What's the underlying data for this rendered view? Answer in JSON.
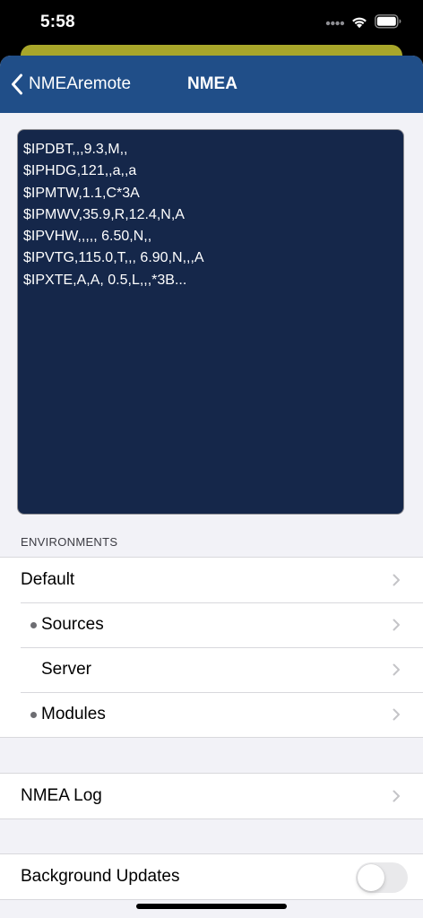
{
  "status_bar": {
    "time": "5:58"
  },
  "colors": {
    "nav_background": "#204e88",
    "log_background": "#15274a",
    "behind_card": "#a8a62a",
    "grouped_background": "#f2f2f7"
  },
  "navbar": {
    "back_label": "NMEAremote",
    "title": "NMEA"
  },
  "nmea_lines": [
    "$IPDBT,,,9.3,M,,",
    "$IPHDG,121,,a,,a",
    "$IPMTW,1.1,C*3A",
    "$IPMWV,35.9,R,12.4,N,A",
    "$IPVHW,,,,, 6.50,N,,",
    "$IPVTG,115.0,T,,, 6.90,N,,,A",
    "$IPXTE,A,A, 0.5,L,,,*3B..."
  ],
  "environments": {
    "header": "ENVIRONMENTS",
    "items": [
      {
        "label": "Default"
      },
      {
        "label": "Sources"
      },
      {
        "label": "Server"
      },
      {
        "label": "Modules"
      }
    ]
  },
  "log_item": {
    "label": "NMEA Log"
  },
  "background_updates": {
    "label": "Background Updates",
    "enabled": false
  }
}
